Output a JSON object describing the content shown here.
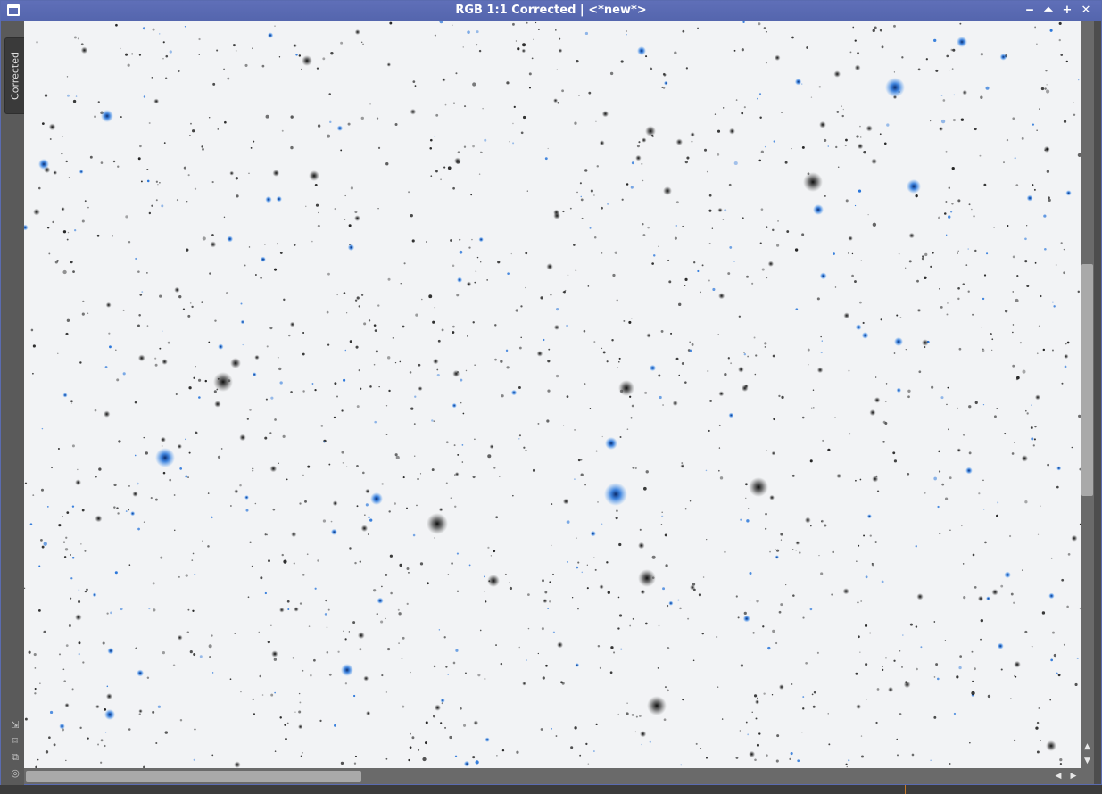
{
  "window": {
    "title": "RGB 1:1 Corrected | <*new*>",
    "buttons": {
      "minimize": "‒",
      "shade": "⏶",
      "maximize": "+",
      "close": "✕"
    }
  },
  "sidebar": {
    "tab_label": "Corrected",
    "tools": [
      {
        "icon": "fit-view-icon",
        "glyph": "⇲"
      },
      {
        "icon": "crop-mode-icon",
        "glyph": "⌑"
      },
      {
        "icon": "clone-icon",
        "glyph": "⧉"
      },
      {
        "icon": "target-icon",
        "glyph": "◎"
      }
    ]
  },
  "scrollbars": {
    "vertical_up": "▲",
    "vertical_down": "▼",
    "horizontal_left": "◀",
    "horizontal_right": "▶"
  },
  "colors": {
    "titlebar": "#5a6bb0",
    "image_background": "#f2f3f5",
    "star_dark": "#1a1a1a",
    "star_blue": "#1f6fd8"
  }
}
